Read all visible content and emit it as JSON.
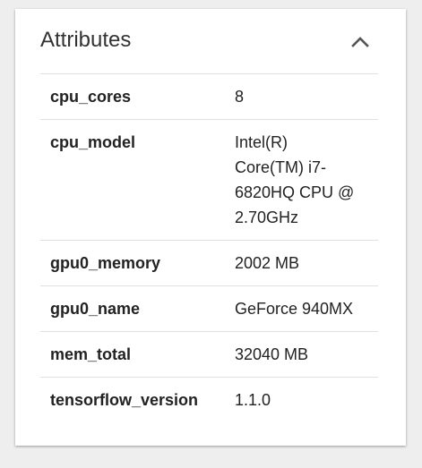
{
  "card": {
    "title": "Attributes",
    "collapse_icon": "chevron-up-icon"
  },
  "attributes": [
    {
      "key": "cpu_cores",
      "value": "8"
    },
    {
      "key": "cpu_model",
      "value": "Intel(R)\nCore(TM) i7-\n6820HQ CPU @\n2.70GHz"
    },
    {
      "key": "gpu0_memory",
      "value": "2002 MB"
    },
    {
      "key": "gpu0_name",
      "value": "GeForce 940MX"
    },
    {
      "key": "mem_total",
      "value": "32040 MB"
    },
    {
      "key": "tensorflow_version",
      "value": "1.1.0"
    }
  ],
  "colors": {
    "background": "#eeeeee",
    "card": "#ffffff",
    "divider": "#e0e0e0",
    "text": "#222222",
    "icon": "#555555"
  }
}
